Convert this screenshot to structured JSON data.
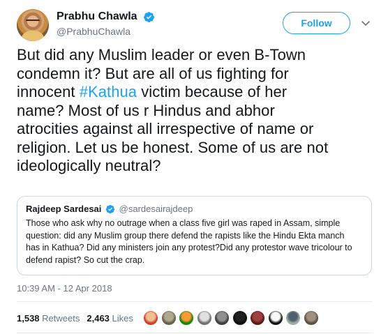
{
  "author": {
    "name": "Prabhu Chawla",
    "handle": "@PrabhuChawla",
    "verified_color": "#1da1f2"
  },
  "follow_label": "Follow",
  "tweet": {
    "lines": [
      "But did any Muslim leader or even B-Town",
      "condemn it? But are all of us fighting for",
      "victim because of her",
      "name? Most of us r Hindus and abhor",
      "atrocities against all irrespective of name or",
      "religion. Let us be honest. Some of us are not",
      "ideologically neutral?"
    ],
    "line3_prefix": "innocent ",
    "hashtag": "#Kathua",
    "line3_suffix": " victim because of her"
  },
  "quoted": {
    "name": "Rajdeep Sardesai",
    "handle": "@sardesairajdeep",
    "lines": [
      "Those who ask why no outrage when a class five girl was raped in Assam, simple",
      "question: did any Muslim group there defend the rapists like the Hindu Ekta manch",
      "has in Kathua? Did any ministers join any protest?Did any protestor wave tricolour to",
      "defend rapist? So cut the crap."
    ]
  },
  "timestamp": "10:39 AM - 12 Apr 2018",
  "stats": {
    "retweets_count": "1,538",
    "retweets_label": "Retweets",
    "likes_count": "2,463",
    "likes_label": "Likes"
  },
  "liker_avatars": [
    {
      "name": "liker-avatar-1",
      "colors": [
        "#f0c090",
        "#d04030"
      ]
    },
    {
      "name": "liker-avatar-2",
      "colors": [
        "#b0a890",
        "#6a6050"
      ]
    },
    {
      "name": "liker-avatar-3",
      "colors": [
        "#ff9933",
        "#138808"
      ]
    },
    {
      "name": "liker-avatar-4",
      "colors": [
        "#e0e0e0",
        "#707070"
      ]
    },
    {
      "name": "liker-avatar-5",
      "colors": [
        "#909090",
        "#404040"
      ]
    },
    {
      "name": "liker-avatar-6",
      "colors": [
        "#202020",
        "#101010"
      ]
    },
    {
      "name": "liker-avatar-7",
      "colors": [
        "#a04040",
        "#601818"
      ]
    },
    {
      "name": "liker-avatar-8",
      "colors": [
        "#f8f8f8",
        "#101010"
      ]
    },
    {
      "name": "liker-avatar-9",
      "colors": [
        "#506070",
        "#a0b0a0"
      ]
    },
    {
      "name": "liker-avatar-10",
      "colors": [
        "#a09080",
        "#605040"
      ]
    }
  ]
}
